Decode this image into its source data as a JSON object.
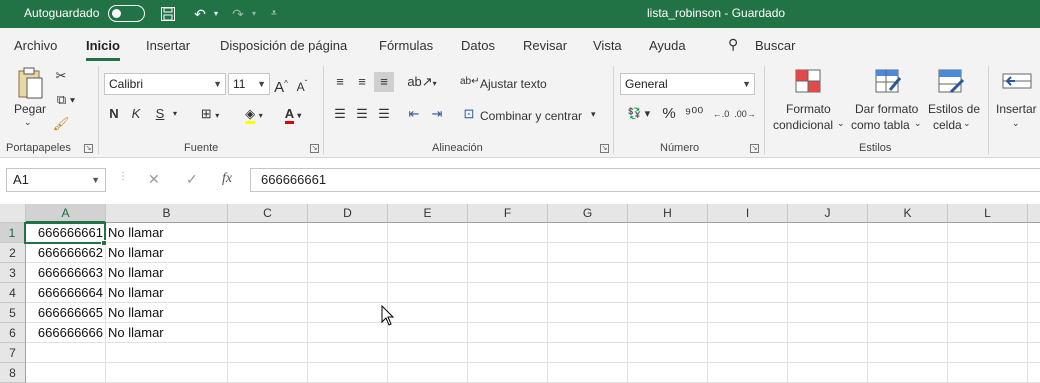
{
  "titlebar": {
    "autosave_label": "Autoguardado",
    "document_title": "lista_robinson  -  Guardado",
    "background_color": "#217346"
  },
  "tabs": [
    "Archivo",
    "Inicio",
    "Insertar",
    "Disposición de página",
    "Fórmulas",
    "Datos",
    "Revisar",
    "Vista",
    "Ayuda"
  ],
  "search_label": "Buscar",
  "ribbon": {
    "clipboard": {
      "paste_label": "Pegar",
      "group_label": "Portapapeles"
    },
    "font": {
      "font_name": "Calibri",
      "font_size": "11",
      "bold": "N",
      "italic": "K",
      "underline": "S",
      "group_label": "Fuente"
    },
    "alignment": {
      "wrap_text": "Ajustar texto",
      "merge_center": "Combinar y centrar",
      "group_label": "Alineación"
    },
    "number": {
      "format": "General",
      "group_label": "Número"
    },
    "styles": {
      "conditional_format_line1": "Formato",
      "conditional_format_line2": "condicional",
      "table_format_line1": "Dar formato",
      "table_format_line2": "como tabla",
      "cell_styles_line1": "Estilos de",
      "cell_styles_line2": "celda",
      "group_label": "Estilos"
    },
    "cells": {
      "insert_label": "Insertar"
    }
  },
  "formula_bar": {
    "name_box": "A1",
    "fx": "fx",
    "value": "666666661"
  },
  "sheet": {
    "columns": [
      "A",
      "B",
      "C",
      "D",
      "E",
      "F",
      "G",
      "H",
      "I",
      "J",
      "K",
      "L"
    ],
    "rows": [
      "1",
      "2",
      "3",
      "4",
      "5",
      "6",
      "7",
      "8"
    ],
    "data": [
      {
        "a": "666666661",
        "b": "No llamar"
      },
      {
        "a": "666666662",
        "b": "No llamar"
      },
      {
        "a": "666666663",
        "b": "No llamar"
      },
      {
        "a": "666666664",
        "b": "No llamar"
      },
      {
        "a": "666666665",
        "b": "No llamar"
      },
      {
        "a": "666666666",
        "b": "No llamar"
      }
    ],
    "selected_cell": "A1",
    "accent_color": "#217346"
  }
}
